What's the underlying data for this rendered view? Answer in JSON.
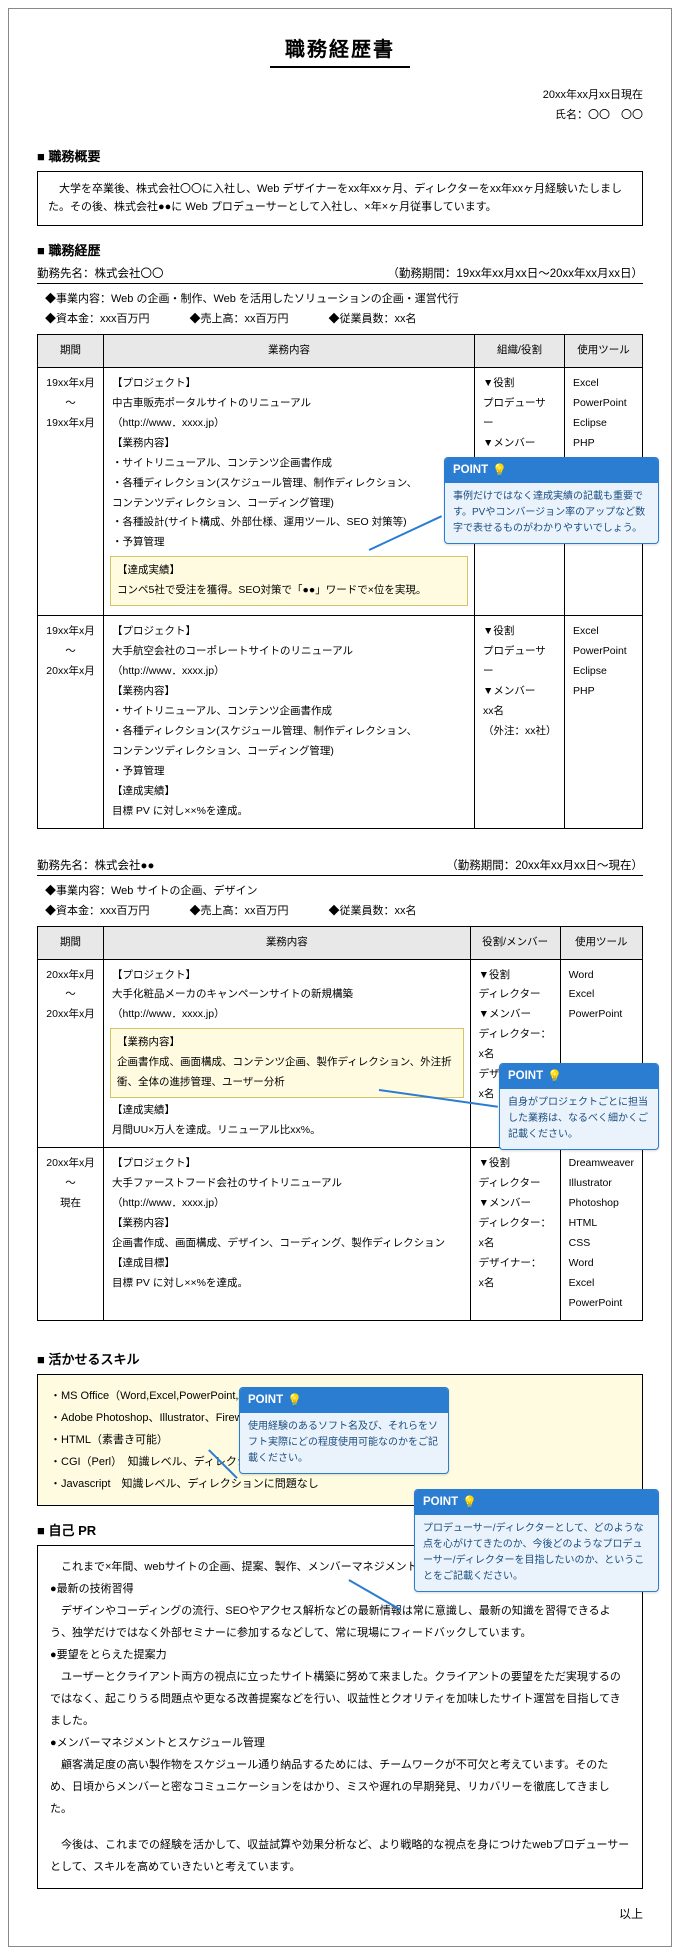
{
  "title": "職務経歴書",
  "date": "20xx年xx月xx日現在",
  "name_label": "氏名：〇〇　〇〇",
  "section_outline": "職務概要",
  "outline_text": "　大学を卒業後、株式会社〇〇に入社し、Web デザイナーをxx年xxヶ月、ディレクターをxx年xxヶ月経験いたしました。その後、株式会社●●に Web プロデューサーとして入社し、×年×ヶ月従事しています。",
  "section_career": "職務経歴",
  "workplace1": {
    "name": "勤務先名：株式会社〇〇",
    "period": "（勤務期間：19xx年xx月xx日〜20xx年xx月xx日）",
    "biz": "◆事業内容：Web の企画・制作、Web を活用したソリューションの企画・運営代行",
    "cap": "資本金：xxx百万円",
    "sales": "売上高：xx百万円",
    "emp": "従業員数：xx名",
    "th_period": "期間",
    "th_work": "業務内容",
    "th_role": "組織/役割",
    "th_tools": "使用ツール",
    "rows": [
      {
        "period": "19xx年x月\n〜\n19xx年x月",
        "work_plain1": "【プロジェクト】\n中古車販売ポータルサイトのリニューアル\n（http://www．xxxx.jp）\n【業務内容】\n・サイトリニューアル、コンテンツ企画書作成\n・各種ディレクション(スケジュール管理、制作ディレクション、\nコンテンツディレクション、コーディング管理)\n・各種設計(サイト構成、外部仕様、運用ツール、SEO 対策等)\n・予算管理",
        "work_hl": "【達成実績】\nコンペ5社で受注を獲得。SEO対策で「●●」ワードで×位を実現。",
        "role": "▼役割\nプロデューサー\n▼メンバー\nxx名\n（外注：xx社）",
        "tools": "Excel\nPowerPoint\nEclipse\nPHP"
      },
      {
        "period": "19xx年x月\n〜\n20xx年x月",
        "work_plain1": "【プロジェクト】\n大手航空会社のコーポレートサイトのリニューアル\n（http://www．xxxx.jp）\n【業務内容】\n・サイトリニューアル、コンテンツ企画書作成\n・各種ディレクション(スケジュール管理、制作ディレクション、\nコンテンツディレクション、コーディング管理)\n・予算管理\n【達成実績】\n目標 PV に対し××%を達成。",
        "role": "▼役割\nプロデューサー\n▼メンバー\nxx名\n（外注：xx社）",
        "tools": "Excel\nPowerPoint\nEclipse\nPHP"
      }
    ]
  },
  "workplace2": {
    "name": "勤務先名：株式会社●●",
    "period": "（勤務期間：20xx年xx月xx日〜現在）",
    "biz": "◆事業内容：Web サイトの企画、デザイン",
    "cap": "資本金：xxx百万円",
    "sales": "売上高：xx百万円",
    "emp": "従業員数：xx名",
    "th_period": "期間",
    "th_work": "業務内容",
    "th_role": "役割/メンバー",
    "th_tools": "使用ツール",
    "rows": [
      {
        "period": "20xx年x月\n〜\n20xx年x月",
        "work_plain1": "【プロジェクト】\n大手化粧品メーカのキャンペーンサイトの新規構築\n（http://www．xxxx.jp）",
        "work_hl": "【業務内容】\n企画書作成、画面構成、コンテンツ企画、製作ディレクション、外注折衝、全体の進捗管理、ユーザー分析",
        "work_plain2": "【達成実績】\n月間UU×万人を達成。リニューアル比xx%。",
        "role": "▼役割\nディレクター\n▼メンバー\nディレクター：\nx名\nデザイナー：\nx名",
        "tools": "Word\nExcel\nPowerPoint"
      },
      {
        "period": "20xx年x月\n〜\n現在",
        "work_plain1": "【プロジェクト】\n大手ファーストフード会社のサイトリニューアル\n（http://www．xxxx.jp）\n【業務内容】\n企画書作成、画面構成、デザイン、コーディング、製作ディレクション\n【達成目標】\n目標 PV に対し××%を達成。",
        "role": "▼役割\nディレクター\n▼メンバー\nディレクター：\nx名\nデザイナー：\nx名",
        "tools": "Dreamweaver\nIllustrator\nPhotoshop\nHTML\nCSS\nWord\nExcel\nPowerPoint"
      }
    ]
  },
  "section_skills": "活かせるスキル",
  "skills": [
    "・MS Office（Word,Excel,PowerPoint,Access）",
    "・Adobe Photoshop、Illustrator、Fireworks、Dreamweaver、Flash",
    "・HTML（素書き可能）",
    "・CGI（Perl）　知識レベル、ディレクションに問題なし",
    "・Javascript　知識レベル、ディレクションに問題なし"
  ],
  "section_pr": "自己 PR",
  "pr": {
    "intro": "　これまで×年間、webサイトの企画、提案、製作、メンバーマネジメントなどを一通り経験してきました。",
    "h1": "●最新の技術習得",
    "p1": "　デザインやコーディングの流行、SEOやアクセス解析などの最新情報は常に意識し、最新の知識を習得できるよう、独学だけではなく外部セミナーに参加するなどして、常に現場にフィードバックしています。",
    "h2": "●要望をとらえた提案力",
    "p2": "　ユーザーとクライアント両方の視点に立ったサイト構築に努めて来ました。クライアントの要望をただ実現するのではなく、起こりうる問題点や更なる改善提案などを行い、収益性とクオリティを加味したサイト運営を目指してきました。",
    "h3": "●メンバーマネジメントとスケジュール管理",
    "p3": "　顧客満足度の高い製作物をスケジュール通り納品するためには、チームワークが不可欠と考えています。そのため、日頃からメンバーと密なコミュニケーションをはかり、ミスや遅れの早期発見、リカバリーを徹底してきました。",
    "closing_para": "　今後は、これまでの経験を活かして、収益試算や効果分析など、より戦略的な視点を身につけたwebプロデューサーとして、スキルを高めていきたいと考えています。"
  },
  "closing": "以上",
  "points": {
    "label": "POINT",
    "p1": "事例だけではなく達成実績の記載も重要です。PVやコンバージョン率のアップなど数字で表せるものがわかりやすいでしょう。",
    "p2": "自身がプロジェクトごとに担当した業務は、なるべく細かくご記載ください。",
    "p3": "使用経験のあるソフト名及び、それらをソフト実際にどの程度使用可能なのかをご記載ください。",
    "p4": "プロデューサー/ディレクターとして、どのような点を心がけてきたのか、今後どのようなプロデューサー/ディレクターを目指したいのか、ということをご記載ください。"
  }
}
